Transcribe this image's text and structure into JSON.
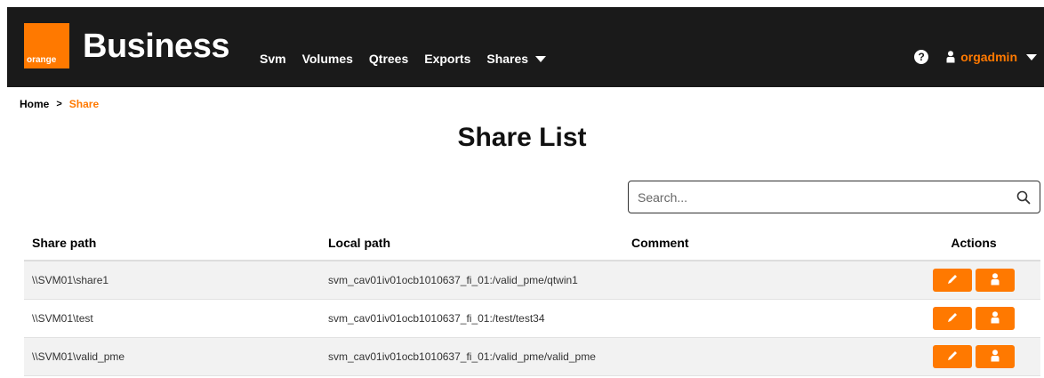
{
  "brand": {
    "logo_text": "orange",
    "name": "Business",
    "accent_color": "#ff7900",
    "navbar_color": "#1a1a1a"
  },
  "nav": {
    "items": [
      {
        "label": "Svm"
      },
      {
        "label": "Volumes"
      },
      {
        "label": "Qtrees"
      },
      {
        "label": "Exports"
      },
      {
        "label": "Shares",
        "has_dropdown": true
      }
    ],
    "help_label": "?",
    "user_name": "orgadmin"
  },
  "breadcrumb": {
    "home": "Home",
    "separator": ">",
    "current": "Share"
  },
  "page": {
    "title": "Share List"
  },
  "search": {
    "placeholder": "Search...",
    "value": ""
  },
  "table": {
    "columns": [
      "Share path",
      "Local path",
      "Comment",
      "Actions"
    ],
    "rows": [
      {
        "share_path": "\\\\SVM01\\share1",
        "local_path": "svm_cav01iv01ocb1010637_fi_01:/valid_pme/qtwin1",
        "comment": ""
      },
      {
        "share_path": "\\\\SVM01\\test",
        "local_path": "svm_cav01iv01ocb1010637_fi_01:/test/test34",
        "comment": ""
      },
      {
        "share_path": "\\\\SVM01\\valid_pme",
        "local_path": "svm_cav01iv01ocb1010637_fi_01:/valid_pme/valid_pme",
        "comment": ""
      }
    ],
    "row_actions": [
      "pencil-icon",
      "user-icon"
    ]
  }
}
